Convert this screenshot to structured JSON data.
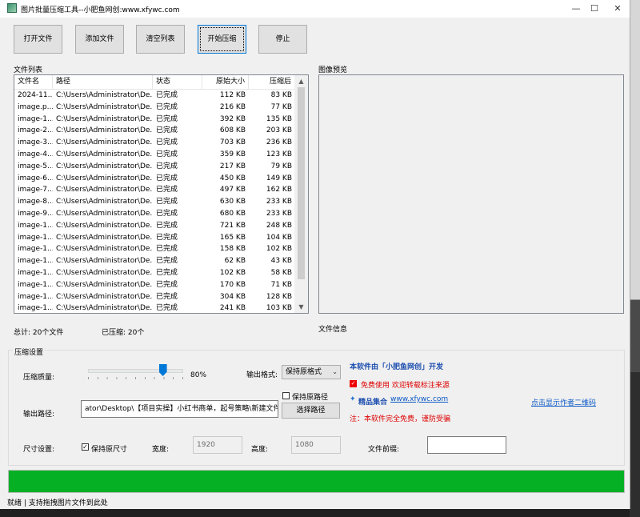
{
  "window": {
    "title": "图片批量压缩工具--小肥鱼网创:www.xfywc.com",
    "minimize": "—",
    "maximize": "☐",
    "close": "✕"
  },
  "toolbar": {
    "open_file": "打开文件",
    "add_file": "添加文件",
    "clear_list": "清空列表",
    "start_compress": "开始压缩",
    "stop": "停止"
  },
  "file_list": {
    "label": "文件列表",
    "columns": [
      "文件名",
      "路径",
      "状态",
      "原始大小",
      "压缩后"
    ],
    "rows": [
      [
        "2024-11...",
        "C:\\Users\\Administrator\\De...",
        "已完成",
        "112 KB",
        "83 KB"
      ],
      [
        "image.p...",
        "C:\\Users\\Administrator\\De...",
        "已完成",
        "216 KB",
        "77 KB"
      ],
      [
        "image-1...",
        "C:\\Users\\Administrator\\De...",
        "已完成",
        "392 KB",
        "135 KB"
      ],
      [
        "image-2...",
        "C:\\Users\\Administrator\\De...",
        "已完成",
        "608 KB",
        "203 KB"
      ],
      [
        "image-3...",
        "C:\\Users\\Administrator\\De...",
        "已完成",
        "703 KB",
        "236 KB"
      ],
      [
        "image-4...",
        "C:\\Users\\Administrator\\De...",
        "已完成",
        "359 KB",
        "123 KB"
      ],
      [
        "image-5...",
        "C:\\Users\\Administrator\\De...",
        "已完成",
        "217 KB",
        "79 KB"
      ],
      [
        "image-6...",
        "C:\\Users\\Administrator\\De...",
        "已完成",
        "450 KB",
        "149 KB"
      ],
      [
        "image-7...",
        "C:\\Users\\Administrator\\De...",
        "已完成",
        "497 KB",
        "162 KB"
      ],
      [
        "image-8...",
        "C:\\Users\\Administrator\\De...",
        "已完成",
        "630 KB",
        "233 KB"
      ],
      [
        "image-9...",
        "C:\\Users\\Administrator\\De...",
        "已完成",
        "680 KB",
        "233 KB"
      ],
      [
        "image-1...",
        "C:\\Users\\Administrator\\De...",
        "已完成",
        "721 KB",
        "248 KB"
      ],
      [
        "image-1...",
        "C:\\Users\\Administrator\\De...",
        "已完成",
        "165 KB",
        "104 KB"
      ],
      [
        "image-1...",
        "C:\\Users\\Administrator\\De...",
        "已完成",
        "158 KB",
        "102 KB"
      ],
      [
        "image-1...",
        "C:\\Users\\Administrator\\De...",
        "已完成",
        "62 KB",
        "43 KB"
      ],
      [
        "image-1...",
        "C:\\Users\\Administrator\\De...",
        "已完成",
        "102 KB",
        "58 KB"
      ],
      [
        "image-1...",
        "C:\\Users\\Administrator\\De...",
        "已完成",
        "170 KB",
        "71 KB"
      ],
      [
        "image-1...",
        "C:\\Users\\Administrator\\De...",
        "已完成",
        "304 KB",
        "128 KB"
      ],
      [
        "image-1...",
        "C:\\Users\\Administrator\\De...",
        "已完成",
        "241 KB",
        "103 KB"
      ]
    ]
  },
  "preview": {
    "label": "图像预览",
    "file_info": "文件信息"
  },
  "summary": {
    "total": "总计: 20个文件",
    "compressed": "已压缩: 20个"
  },
  "settings": {
    "group_title": "压缩设置",
    "quality_label": "压缩质量:",
    "quality_value": "80%",
    "quality_level": 0.8,
    "format_label": "输出格式:",
    "format_selected": "保持原格式",
    "output_path_label": "输出路径:",
    "output_path_value": "ator\\Desktop\\【项目实操】小红书商单，起号策略\\新建文件夹",
    "keep_original_path": "保持原路径",
    "choose_path": "选择路径",
    "size_label": "尺寸设置:",
    "keep_size": "保持原尺寸",
    "width_label": "宽度:",
    "width_value": "1920",
    "height_label": "高度:",
    "height_value": "1080",
    "prefix_label": "文件前缀:",
    "prefix_value": ""
  },
  "promo": {
    "developer": "本软件由「小肥鱼网创」开发",
    "free_use": "免费使用 欢迎转载标注来源",
    "collection": "精品集合",
    "website": "www.xfywc.com",
    "qr_link": "点击显示作者二维码",
    "warning": "注：本软件完全免费，谨防受骗"
  },
  "progress": {
    "value": 1.0
  },
  "status": {
    "text": "就绪 | 支持拖拽图片文件到此处"
  },
  "colors": {
    "accent": "#0078d7",
    "progress": "#06b025",
    "warning": "#dd0000",
    "brand_blue": "#1f4fb0"
  }
}
